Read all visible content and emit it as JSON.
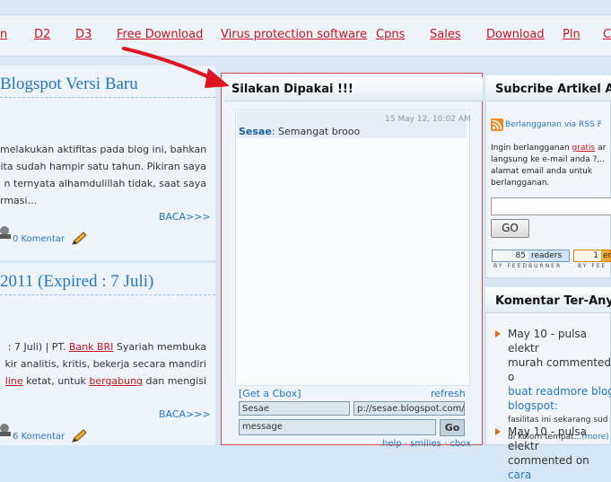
{
  "nav": {
    "links": [
      {
        "label": "n"
      },
      {
        "label": "D2"
      },
      {
        "label": "D3"
      },
      {
        "label": "Free Download"
      },
      {
        "label": "Virus protection software"
      },
      {
        "label": "Cpns"
      },
      {
        "label": "Sales"
      },
      {
        "label": "Download"
      },
      {
        "label": "Pln"
      },
      {
        "label": "Cn"
      }
    ]
  },
  "posts": [
    {
      "title": "Blogspot Versi Baru",
      "lines": [
        "melakukan aktifitas pada blog ini, bahkan",
        "ita sudah hampir satu tahun. Pikiran saya",
        "n ternyata alhamdulillah tidak, saat saya",
        "rmasi..."
      ],
      "read_more": "BACA>>>",
      "comments": "0 Komentar"
    },
    {
      "title": "2011 (Expired : 7 Juli)",
      "line1_prefix": ": 7 Juli) | PT. ",
      "line1_link": "Bank BRI",
      "line1_suffix": " Syariah membuka",
      "line2": "kir analitis, kritis, bekerja secara mandiri",
      "line3_link1": "line",
      "line3_mid": " ketat, untuk ",
      "line3_link2": "bergabung",
      "line3_suffix": " dan mengisi",
      "read_more": "BACA>>>",
      "comments": "6 Komentar"
    }
  ],
  "cbox": {
    "title": "Silakan Dipakai !!!",
    "message": {
      "time": "15 May 12, 10:02 AM",
      "author": "Sesae",
      "text": ": Semangat brooo"
    },
    "get_cbox": "[Get a Cbox]",
    "refresh": "refresh",
    "name_value": "Sesae",
    "url_value": "p://sesae.blogspot.com/",
    "message_placeholder": "message",
    "go": "Go",
    "footer": "help · smilies · cbox"
  },
  "subscribe": {
    "title": "Subcribe Artikel An",
    "rss_link": "Berlangganan via RSS F",
    "text_lines": [
      "Ingin berlangganan ",
      "langsung ke e-mail anda ?,..",
      "alamat email anda untuk",
      "berlangganan."
    ],
    "gratis": "gratis",
    "gratis_suffix": " ar",
    "go_label": "GO",
    "feed1_count": "85",
    "feed1_label": "readers",
    "feed2_count": "1",
    "feed2_label": "en",
    "feed_caption1": "BY FEEDBURNER",
    "feed_caption2": "BY FEE"
  },
  "comments_widget": {
    "title": "Komentar Ter-Anya",
    "items": [
      {
        "line1": "May 10 - pulsa elektr",
        "line2": "murah commented o",
        "link": "buat readmore blog",
        "link2": "blogspot:",
        "snippet1": "fasilitas ini sekarang sud",
        "snippet2": "di kolom tempat...",
        "more": "(more)"
      },
      {
        "line1": "May 10 - pulsa elektr",
        "line2": "commented on ",
        "link": "cara"
      }
    ]
  },
  "colors": {
    "link_red": "#c8141e",
    "link_blue": "#2476c9",
    "arrow_red": "#e0141e",
    "box_border": "#d84a4a"
  }
}
